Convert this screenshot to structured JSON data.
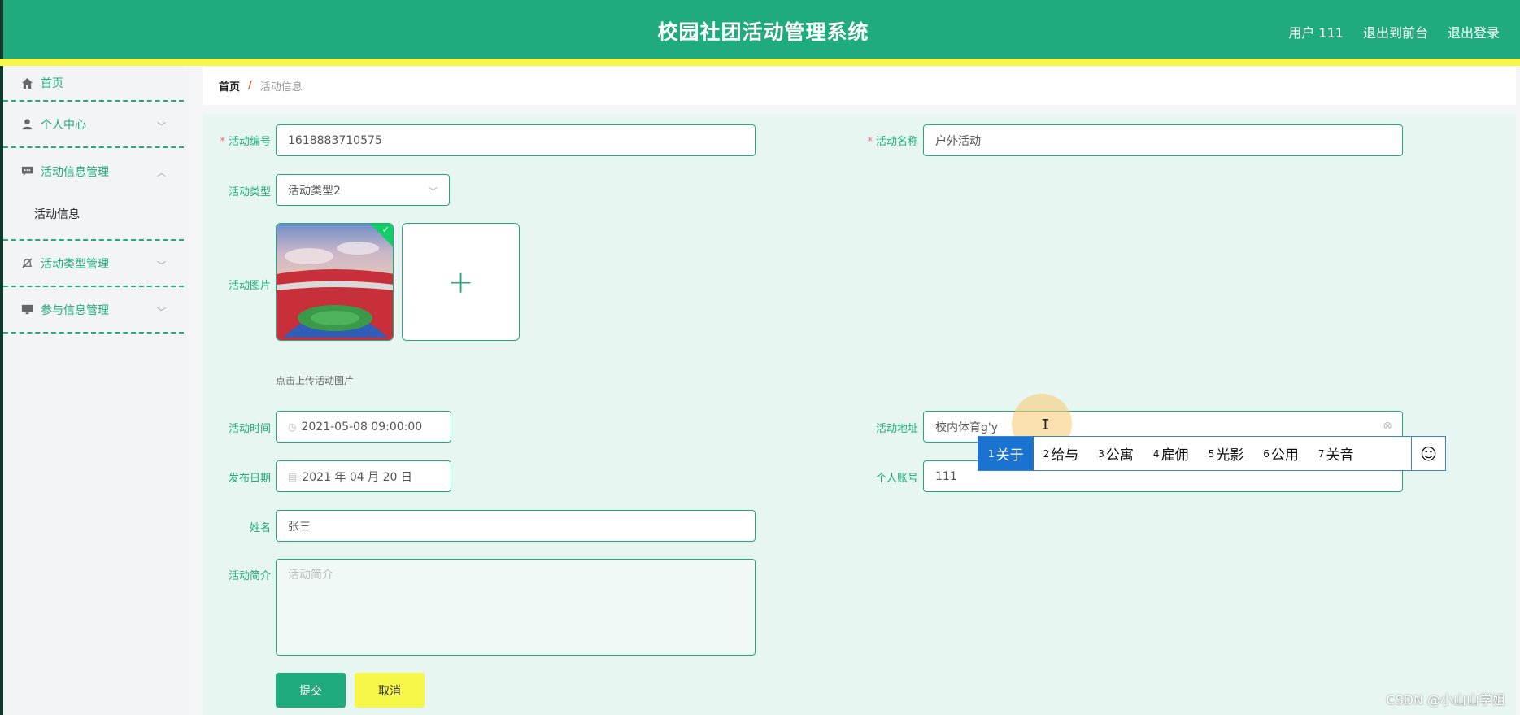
{
  "header": {
    "title": "校园社团活动管理系统",
    "user": "用户 111",
    "back_front": "退出到前台",
    "logout": "退出登录"
  },
  "sidebar": {
    "items": [
      {
        "label": "首页",
        "icon": "home-icon"
      },
      {
        "label": "个人中心",
        "icon": "user-icon"
      },
      {
        "label": "活动信息管理",
        "icon": "chat-icon",
        "expanded": true,
        "children": [
          {
            "label": "活动信息"
          }
        ]
      },
      {
        "label": "活动类型管理",
        "icon": "bell-off-icon"
      },
      {
        "label": "参与信息管理",
        "icon": "monitor-icon"
      }
    ]
  },
  "breadcrumb": {
    "home": "首页",
    "sep": "/",
    "current": "活动信息"
  },
  "form": {
    "activity_id": {
      "label": "活动编号",
      "value": "1618883710575",
      "required": true
    },
    "activity_name": {
      "label": "活动名称",
      "value": "户外活动",
      "required": true
    },
    "activity_type": {
      "label": "活动类型",
      "value": "活动类型2"
    },
    "activity_image": {
      "label": "活动图片",
      "hint": "点击上传活动图片"
    },
    "activity_time": {
      "label": "活动时间",
      "value": "2021-05-08 09:00:00"
    },
    "activity_address": {
      "label": "活动地址",
      "value": "校内体育g'y"
    },
    "publish_date": {
      "label": "发布日期",
      "value": "2021 年 04 月 20 日"
    },
    "account": {
      "label": "个人账号",
      "value": "111"
    },
    "name": {
      "label": "姓名",
      "value": "张三"
    },
    "intro": {
      "label": "活动简介",
      "placeholder": "活动简介"
    },
    "submit": "提交",
    "cancel": "取消"
  },
  "ime": {
    "candidates": [
      {
        "num": "1",
        "text": "关于"
      },
      {
        "num": "2",
        "text": "给与"
      },
      {
        "num": "3",
        "text": "公寓"
      },
      {
        "num": "4",
        "text": "雇佣"
      },
      {
        "num": "5",
        "text": "光影"
      },
      {
        "num": "6",
        "text": "公用"
      },
      {
        "num": "7",
        "text": "关音"
      }
    ],
    "emoji": "☺"
  },
  "watermark": "CSDN @小山山学姐",
  "colors": {
    "primary": "#1fab7e",
    "accent_yellow": "#f7f74a",
    "form_bg": "#e8f6f1"
  }
}
